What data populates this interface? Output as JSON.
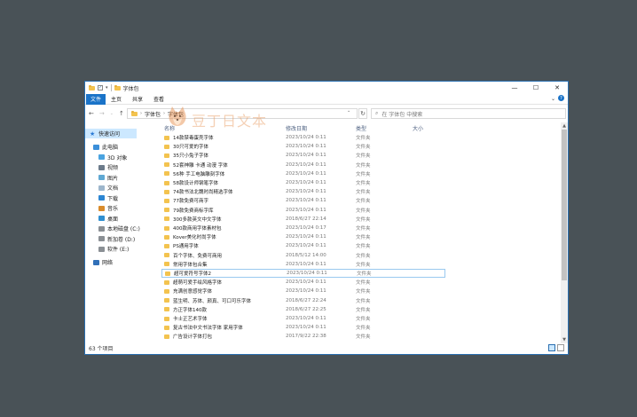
{
  "window": {
    "title": "字体包",
    "controls": [
      "—",
      "☐",
      "✕"
    ]
  },
  "ribbon": {
    "tabs": [
      "文件",
      "主页",
      "共享",
      "查看"
    ],
    "expand_icon": "chevron-down",
    "help_icon": "?"
  },
  "address": {
    "path": [
      "字体包",
      "字体包"
    ],
    "search_placeholder": "在 字体包 中搜索"
  },
  "columns": {
    "name": "名称",
    "date": "修改日期",
    "type": "类型",
    "size": "大小"
  },
  "sidebar": {
    "items": [
      {
        "label": "快速访问",
        "icon": "star-icon"
      },
      {
        "label": "此电脑",
        "icon": "computer-icon"
      },
      {
        "label": "3D 对象",
        "icon": "3d-objects-icon"
      },
      {
        "label": "视频",
        "icon": "video-icon"
      },
      {
        "label": "图片",
        "icon": "pictures-icon"
      },
      {
        "label": "文档",
        "icon": "documents-icon"
      },
      {
        "label": "下载",
        "icon": "download-icon"
      },
      {
        "label": "音乐",
        "icon": "music-icon"
      },
      {
        "label": "桌面",
        "icon": "desktop-icon"
      },
      {
        "label": "本地磁盘 (C:)",
        "icon": "disk-icon"
      },
      {
        "label": "新加卷 (D:)",
        "icon": "disk-icon"
      },
      {
        "label": "软件 (E:)",
        "icon": "disk-icon"
      },
      {
        "label": "网络",
        "icon": "network-icon"
      }
    ]
  },
  "files": [
    {
      "name": "14款禁毒蛋壳字体",
      "date": "2023/10/24 0:11",
      "type": "文件夹"
    },
    {
      "name": "30只可爱的字体",
      "date": "2023/10/24 0:11",
      "type": "文件夹"
    },
    {
      "name": "35只小兔子字体",
      "date": "2023/10/24 0:11",
      "type": "文件夹"
    },
    {
      "name": "52套神雕 卡通 动漫 字体",
      "date": "2023/10/24 0:11",
      "type": "文件夹"
    },
    {
      "name": "56种 手工电脑雕刻字体",
      "date": "2023/10/24 0:11",
      "type": "文件夹"
    },
    {
      "name": "58款设计师钢笔字体",
      "date": "2023/10/24 0:11",
      "type": "文件夹"
    },
    {
      "name": "74款书法北魏时尚精选字体",
      "date": "2023/10/24 0:11",
      "type": "文件夹"
    },
    {
      "name": "77款免费可商字",
      "date": "2023/10/24 0:11",
      "type": "文件夹"
    },
    {
      "name": "79款免费商标字库",
      "date": "2023/10/24 0:11",
      "type": "文件夹"
    },
    {
      "name": "300多款英文中文字体",
      "date": "2018/6/27 22:14",
      "type": "文件夹"
    },
    {
      "name": "400款商用字体素材包",
      "date": "2023/10/24 0:17",
      "type": "文件夹"
    },
    {
      "name": "Kover美化时尚字体",
      "date": "2023/10/24 0:11",
      "type": "文件夹"
    },
    {
      "name": "PS通用字体",
      "date": "2023/10/24 0:11",
      "type": "文件夹"
    },
    {
      "name": "百个字体、免费可商用",
      "date": "2018/5/12 14:00",
      "type": "文件夹"
    },
    {
      "name": "常用字体包合集",
      "date": "2023/10/24 0:11",
      "type": "文件夹"
    },
    {
      "name": "超可爱符号字体2",
      "date": "2023/10/24 0:11",
      "type": "文件夹"
    },
    {
      "name": "超萌可爱手绘风格字体",
      "date": "2023/10/24 0:11",
      "type": "文件夹"
    },
    {
      "name": "充满创意感觉字体",
      "date": "2023/10/24 0:11",
      "type": "文件夹"
    },
    {
      "name": "蓝生明、苏体、颜真、可口可乐字体",
      "date": "2018/6/27 22:24",
      "type": "文件夹"
    },
    {
      "name": "方正字体140款",
      "date": "2018/6/27 22:25",
      "type": "文件夹"
    },
    {
      "name": "卡士正艺术字体",
      "date": "2023/10/24 0:11",
      "type": "文件夹"
    },
    {
      "name": "复古书法中文书法字体 家用字体",
      "date": "2023/10/24 0:11",
      "type": "文件夹"
    },
    {
      "name": "广告设计字体打包",
      "date": "2017/9/22 22:38",
      "type": "文件夹"
    }
  ],
  "selected_index": 15,
  "status": {
    "count": "63 个项目"
  },
  "watermark": {
    "text": "豆丁日文本"
  },
  "colors": {
    "accent": "#1a73c8",
    "folder": "#f3c34f",
    "selection": "#cce8ff",
    "desktop": "#495257"
  }
}
